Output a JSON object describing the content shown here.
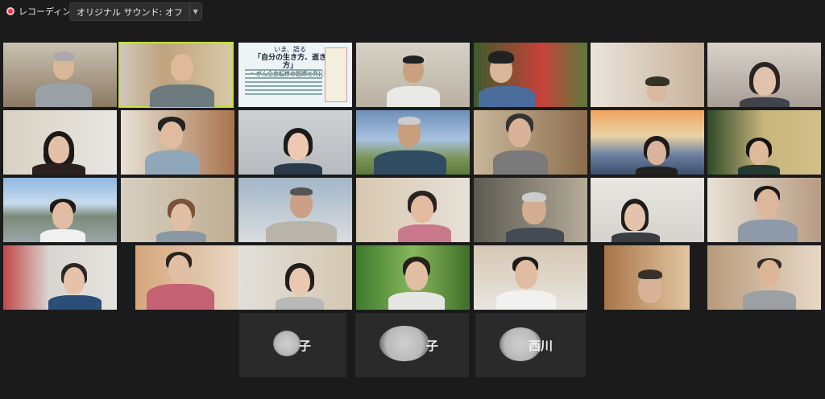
{
  "toolbar": {
    "recording_label": "レコーディング",
    "original_sound_label": "オリジナル サウンド: オフ",
    "record_icon": "record-icon",
    "dropdown_icon": "chevron-down-icon"
  },
  "book_screen": {
    "title_line1": "いま、語る",
    "title_line2": "「自分の生き方、逝き方」",
    "subtitle": "〜がん全身転移の医師と共に〜"
  },
  "name_tiles": [
    {
      "suffix": "子"
    },
    {
      "suffix": "子"
    },
    {
      "suffix": "西川"
    }
  ],
  "colors": {
    "active_speaker_border": "#c5e03a",
    "background": "#1b1b1b"
  }
}
